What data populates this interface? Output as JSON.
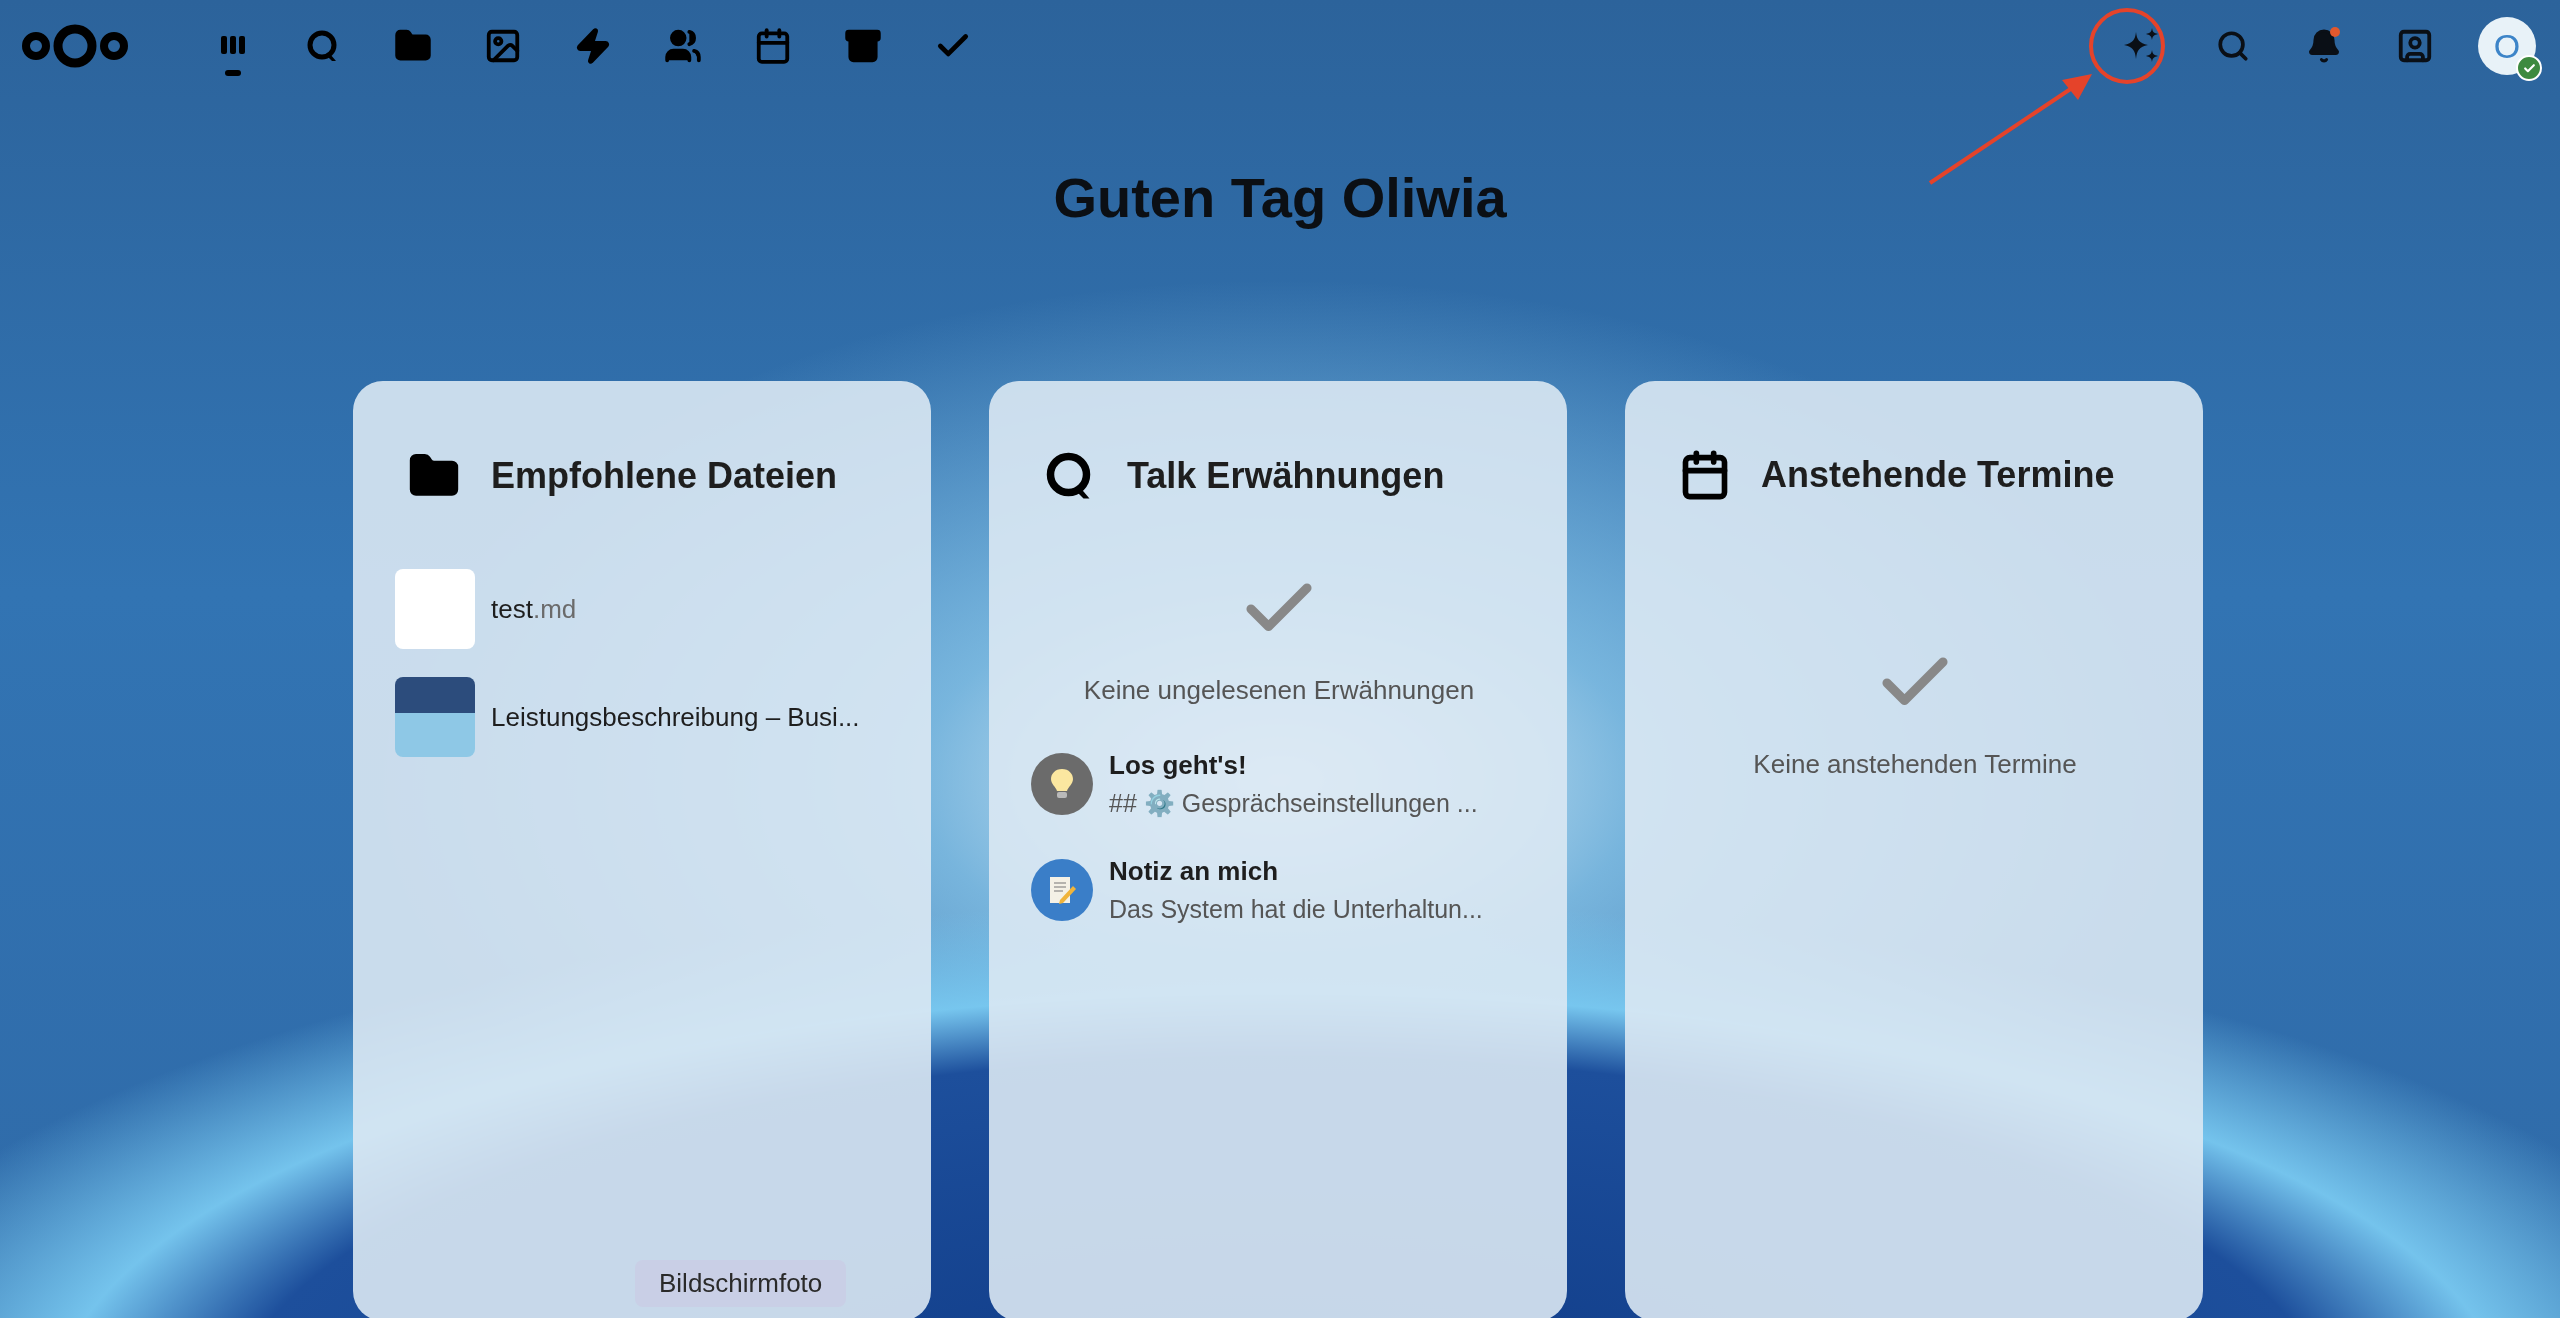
{
  "app_nav": [
    {
      "selected": true
    },
    {
      "selected": false
    },
    {
      "selected": false
    },
    {
      "selected": false
    },
    {
      "selected": false
    },
    {
      "selected": false
    },
    {
      "selected": false
    },
    {
      "selected": false
    },
    {
      "selected": false
    }
  ],
  "header_actions": {
    "notifications_unread": true,
    "avatar": {
      "initial": "O",
      "online": true
    }
  },
  "greeting": "Guten Tag Oliwia",
  "widgets": [
    {
      "kind": "files",
      "title": "Empfohlene Dateien",
      "items": [
        {
          "name": "test",
          "extension": ".md",
          "kind": "blank"
        },
        {
          "name": "Leistungsbeschreibung – Busi...",
          "kind": "picture"
        }
      ]
    },
    {
      "kind": "talk",
      "title": "Talk Erwähnungen",
      "empty_message": "Keine ungelesenen Erwähnungen",
      "items": [
        {
          "title": "Los geht's!",
          "subtitle": "## ⚙️ Gesprächseinstellungen ...",
          "kind": "bulb",
          "color": "#6b6b6b"
        },
        {
          "title": "Notiz an mich",
          "subtitle": "Das System hat die Unterhaltun...",
          "kind": "note",
          "color": "#3a7ec8"
        }
      ]
    },
    {
      "kind": "calendar",
      "title": "Anstehende Termine",
      "empty_message": "Keine anstehenden Termine"
    }
  ],
  "tooltip": "Bildschirmfoto"
}
